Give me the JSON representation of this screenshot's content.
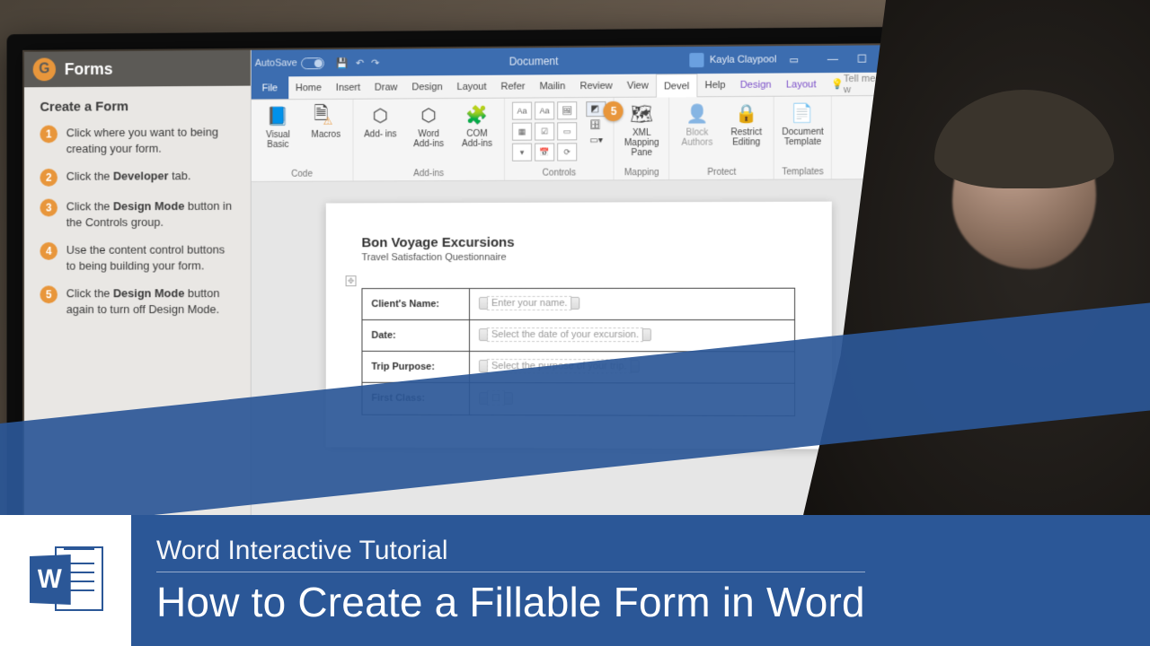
{
  "sidebar": {
    "header": "Forms",
    "title": "Create a Form",
    "steps": [
      {
        "n": "1",
        "html": "Click where you want to being creating your form."
      },
      {
        "n": "2",
        "html": "Click the <b>Developer</b> tab."
      },
      {
        "n": "3",
        "html": "Click the <b>Design Mode</b> button in the Controls group."
      },
      {
        "n": "4",
        "html": "Use the content control buttons to being building your form."
      },
      {
        "n": "5",
        "html": "Click the <b>Design Mode</b> button again to turn off Design Mode."
      }
    ]
  },
  "titlebar": {
    "autosave": "AutoSave",
    "docTitle": "Document",
    "user": "Kayla Claypool"
  },
  "tabs": {
    "file": "File",
    "list": [
      "Home",
      "Insert",
      "Draw",
      "Design",
      "Layout",
      "Refer",
      "Mailin",
      "Review",
      "View",
      "Devel",
      "Help"
    ],
    "active": "Devel",
    "context": [
      "Design",
      "Layout"
    ],
    "tell": "Tell me w"
  },
  "ribbon": {
    "code": {
      "label": "Code",
      "visualBasic": "Visual\nBasic",
      "macros": "Macros"
    },
    "addins": {
      "label": "Add-ins",
      "addins": "Add-\nins",
      "wordAddins": "Word\nAdd-ins",
      "com": "COM\nAdd-ins"
    },
    "controls": {
      "label": "Controls"
    },
    "mapping": {
      "label": "Mapping",
      "xml": "XML Mapping\nPane",
      "badge": "5"
    },
    "protect": {
      "label": "Protect",
      "block": "Block\nAuthors",
      "restrict": "Restrict\nEditing"
    },
    "templates": {
      "label": "Templates",
      "doc": "Document\nTemplate"
    }
  },
  "form": {
    "heading": "Bon Voyage Excursions",
    "sub": "Travel Satisfaction Questionnaire",
    "rows": [
      {
        "label": "Client's Name:",
        "placeholder": "Enter your name."
      },
      {
        "label": "Date:",
        "placeholder": "Select the date of your excursion."
      },
      {
        "label": "Trip Purpose:",
        "placeholder": "Select the purpose of your trip."
      },
      {
        "label": "First Class:",
        "placeholder": "☐"
      }
    ]
  },
  "overlay": {
    "line1": "Word Interactive Tutorial",
    "line2": "How to Create a Fillable Form in Word"
  }
}
